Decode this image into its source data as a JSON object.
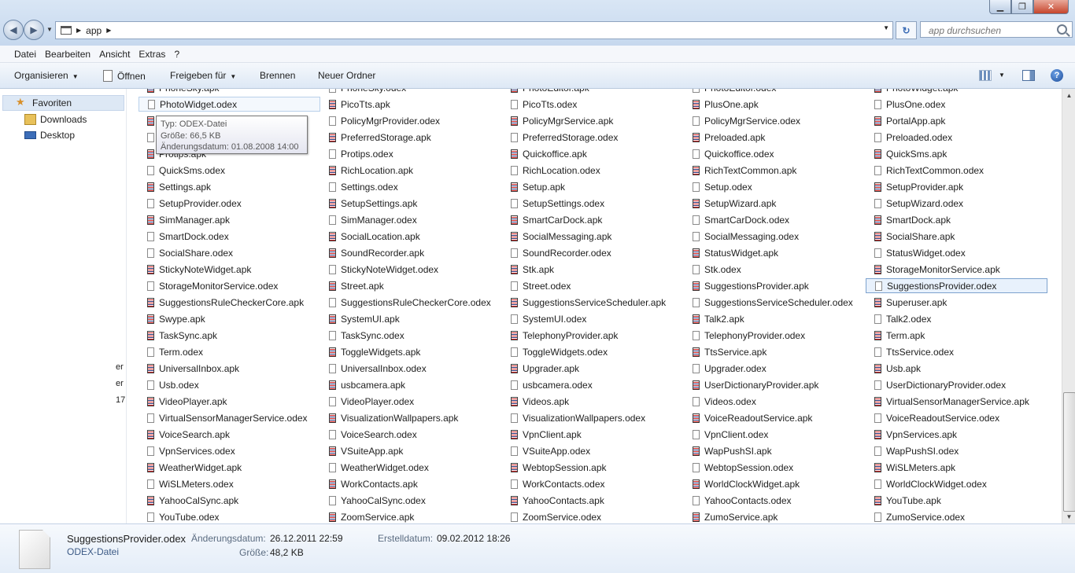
{
  "address": {
    "path": "app",
    "search_placeholder": "app durchsuchen"
  },
  "menu": [
    "Datei",
    "Bearbeiten",
    "Ansicht",
    "Extras",
    "?"
  ],
  "toolbar": {
    "organize": "Organisieren",
    "open": "Öffnen",
    "share": "Freigeben für",
    "burn": "Brennen",
    "new_folder": "Neuer Ordner"
  },
  "nav": {
    "favorites": "Favoriten",
    "downloads": "Downloads",
    "desktop": "Desktop",
    "fragments": [
      "er",
      "er",
      "17"
    ]
  },
  "tooltip": {
    "type": "Typ: ODEX-Datei",
    "size": "Größe: 66,5 KB",
    "date": "Änderungsdatum: 01.08.2008 14:00"
  },
  "columns": [
    [
      "PhoneSky.apk",
      "PhotoWidget.odex",
      "PicoTts.apk",
      "PicoTts.odex",
      "Protips.apk",
      "QuickSms.odex",
      "Settings.apk",
      "SetupProvider.odex",
      "SimManager.apk",
      "SmartDock.odex",
      "SocialShare.odex",
      "StickyNoteWidget.apk",
      "StorageMonitorService.odex",
      "SuggestionsRuleCheckerCore.apk",
      "Swype.apk",
      "TaskSync.apk",
      "Term.odex",
      "UniversalInbox.apk",
      "Usb.odex",
      "VideoPlayer.apk",
      "VirtualSensorManagerService.odex",
      "VoiceSearch.apk",
      "VpnServices.odex",
      "WeatherWidget.apk",
      "WiSLMeters.odex",
      "YahooCalSync.apk",
      "YouTube.odex"
    ],
    [
      "PhoneSky.odex",
      "PicoTts.apk",
      "PolicyMgrProvider.odex",
      "PreferredStorage.apk",
      "Protips.odex",
      "RichLocation.apk",
      "Settings.odex",
      "SetupSettings.apk",
      "SimManager.odex",
      "SocialLocation.apk",
      "SoundRecorder.apk",
      "StickyNoteWidget.odex",
      "Street.apk",
      "SuggestionsRuleCheckerCore.odex",
      "SystemUI.apk",
      "TaskSync.odex",
      "ToggleWidgets.apk",
      "UniversalInbox.odex",
      "usbcamera.apk",
      "VideoPlayer.odex",
      "VisualizationWallpapers.apk",
      "VoiceSearch.odex",
      "VSuiteApp.apk",
      "WeatherWidget.odex",
      "WorkContacts.apk",
      "YahooCalSync.odex",
      "ZoomService.apk"
    ],
    [
      "PhotoEditor.apk",
      "PicoTts.odex",
      "PolicyMgrService.apk",
      "PreferredStorage.odex",
      "Quickoffice.apk",
      "RichLocation.odex",
      "Setup.apk",
      "SetupSettings.odex",
      "SmartCarDock.apk",
      "SocialMessaging.apk",
      "SoundRecorder.odex",
      "Stk.apk",
      "Street.odex",
      "SuggestionsServiceScheduler.apk",
      "SystemUI.odex",
      "TelephonyProvider.apk",
      "ToggleWidgets.odex",
      "Upgrader.apk",
      "usbcamera.odex",
      "Videos.apk",
      "VisualizationWallpapers.odex",
      "VpnClient.apk",
      "VSuiteApp.odex",
      "WebtopSession.apk",
      "WorkContacts.odex",
      "YahooContacts.apk",
      "ZoomService.odex"
    ],
    [
      "PhotoEditor.odex",
      "PlusOne.apk",
      "PolicyMgrService.odex",
      "Preloaded.apk",
      "Quickoffice.odex",
      "RichTextCommon.apk",
      "Setup.odex",
      "SetupWizard.apk",
      "SmartCarDock.odex",
      "SocialMessaging.odex",
      "StatusWidget.apk",
      "Stk.odex",
      "SuggestionsProvider.apk",
      "SuggestionsServiceScheduler.odex",
      "Talk2.apk",
      "TelephonyProvider.odex",
      "TtsService.apk",
      "Upgrader.odex",
      "UserDictionaryProvider.apk",
      "Videos.odex",
      "VoiceReadoutService.apk",
      "VpnClient.odex",
      "WapPushSI.apk",
      "WebtopSession.odex",
      "WorldClockWidget.apk",
      "YahooContacts.odex",
      "ZumoService.apk"
    ],
    [
      "PhotoWidget.apk",
      "PlusOne.odex",
      "PortalApp.apk",
      "Preloaded.odex",
      "QuickSms.apk",
      "RichTextCommon.odex",
      "SetupProvider.apk",
      "SetupWizard.odex",
      "SmartDock.apk",
      "SocialShare.apk",
      "StatusWidget.odex",
      "StorageMonitorService.apk",
      "SuggestionsProvider.odex",
      "Superuser.apk",
      "Talk2.odex",
      "Term.apk",
      "TtsService.odex",
      "Usb.apk",
      "UserDictionaryProvider.odex",
      "VirtualSensorManagerService.apk",
      "VoiceReadoutService.odex",
      "VpnServices.apk",
      "WapPushSI.odex",
      "WiSLMeters.apk",
      "WorldClockWidget.odex",
      "YouTube.apk",
      "ZumoService.odex"
    ]
  ],
  "details": {
    "name": "SuggestionsProvider.odex",
    "type": "ODEX-Datei",
    "modified_label": "Änderungsdatum:",
    "modified_value": "26.12.2011 22:59",
    "size_label": "Größe:",
    "size_value": "48,2 KB",
    "created_label": "Erstelldatum:",
    "created_value": "09.02.2012 18:26"
  },
  "colors": {
    "selection": "#e8f1fc",
    "accent": "#3c5a86",
    "apk_icon_red": "#cc2222"
  }
}
